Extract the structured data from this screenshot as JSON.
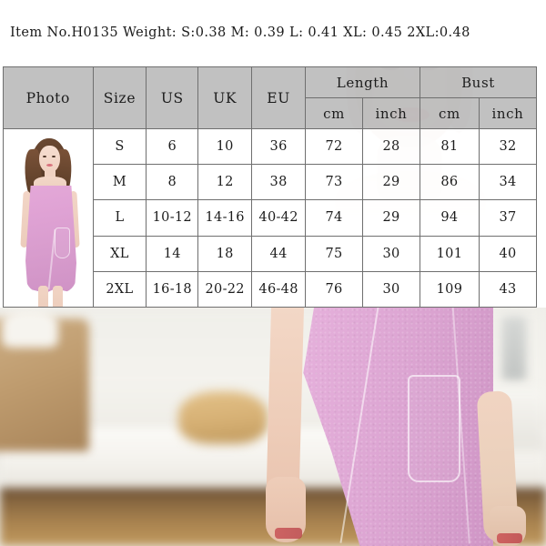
{
  "header": {
    "item_line": "Item No.H0135 Weight: S:0.38  M: 0.39 L: 0.41 XL: 0.45 2XL:0.48"
  },
  "table": {
    "columns": {
      "photo": "Photo",
      "size": "Size",
      "us": "US",
      "uk": "UK",
      "eu": "EU",
      "length": "Length",
      "bust": "Bust",
      "length_cm": "cm",
      "length_inch": "inch",
      "bust_cm": "cm",
      "bust_inch": "inch"
    },
    "rows": [
      {
        "size": "S",
        "us": "6",
        "uk": "10",
        "eu": "36",
        "length_cm": "72",
        "length_inch": "28",
        "bust_cm": "81",
        "bust_inch": "32"
      },
      {
        "size": "M",
        "us": "8",
        "uk": "12",
        "eu": "38",
        "length_cm": "73",
        "length_inch": "29",
        "bust_cm": "86",
        "bust_inch": "34"
      },
      {
        "size": "L",
        "us": "10-12",
        "uk": "14-16",
        "eu": "40-42",
        "length_cm": "74",
        "length_inch": "29",
        "bust_cm": "94",
        "bust_inch": "37"
      },
      {
        "size": "XL",
        "us": "14",
        "uk": "18",
        "eu": "44",
        "length_cm": "75",
        "length_inch": "30",
        "bust_cm": "101",
        "bust_inch": "40"
      },
      {
        "size": "2XL",
        "us": "16-18",
        "uk": "20-22",
        "eu": "46-48",
        "length_cm": "76",
        "length_inch": "30",
        "bust_cm": "109",
        "bust_inch": "43"
      }
    ]
  },
  "colors": {
    "header_bg": "#b7b7b7",
    "cell_bg": "#ffffff",
    "border": "#6f6f6f",
    "text": "#1c1c1c",
    "product_pink": "#dda6d3",
    "wood_brown": "#a9834f"
  },
  "photos": {
    "thumbnail_alt": "model-in-pink-towel-wrap-dress",
    "hero_alt": "closeup-pink-towel-wrap-dress-in-bathroom"
  }
}
